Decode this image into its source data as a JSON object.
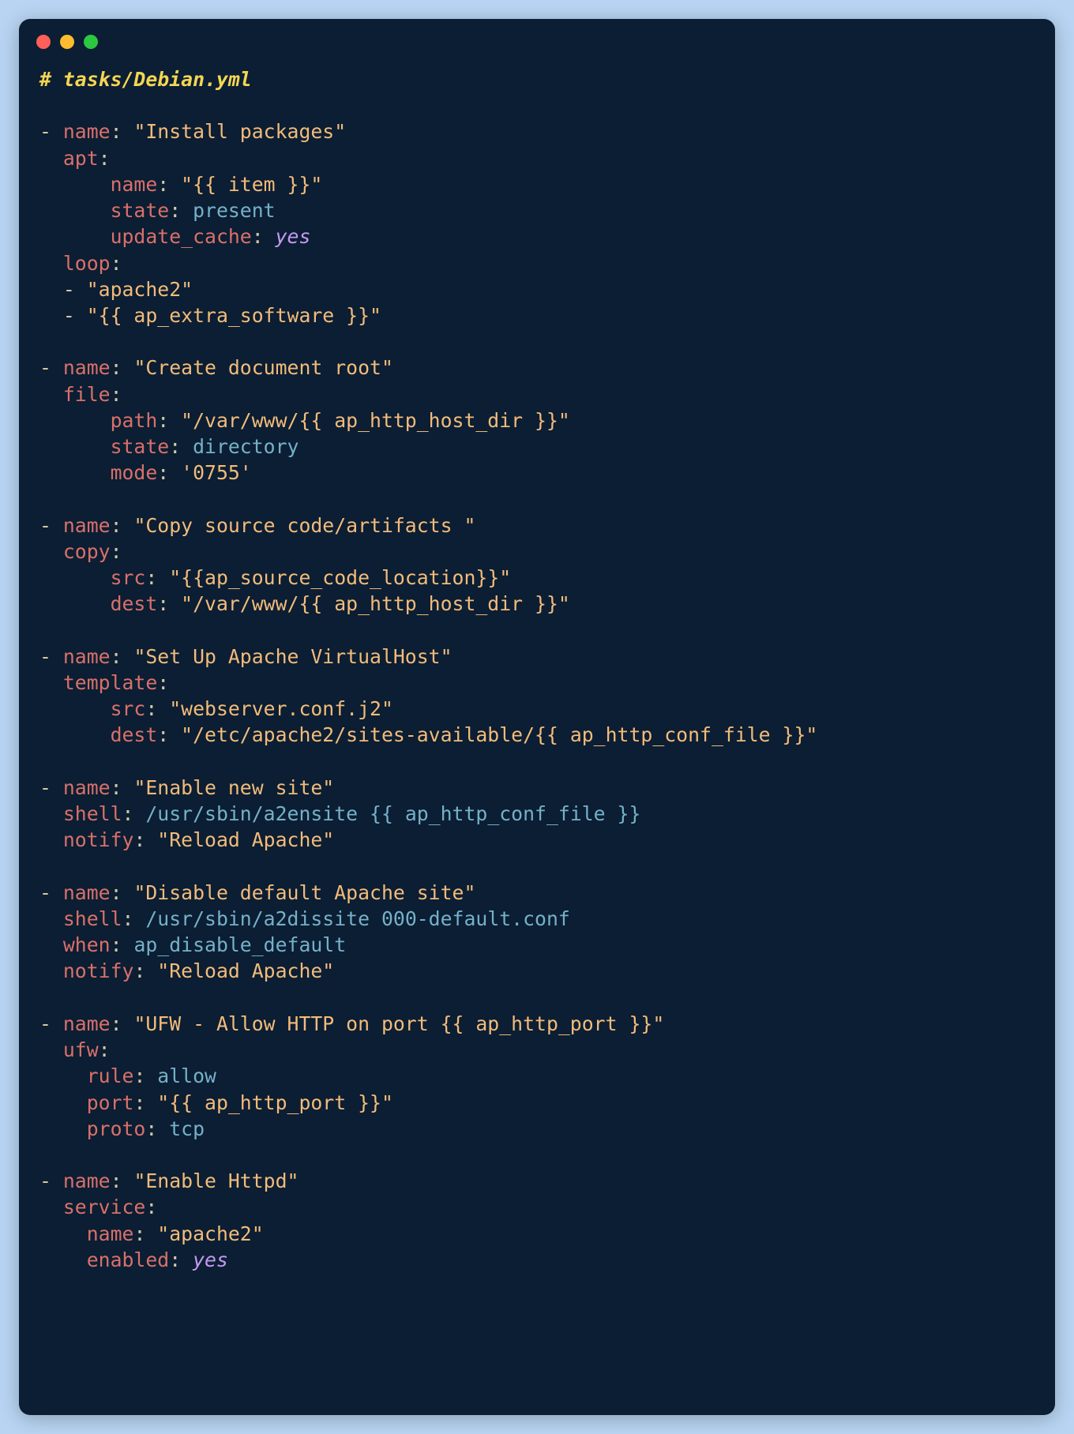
{
  "comment": "# tasks/Debian.yml",
  "tasks": [
    {
      "name": "\"Install packages\"",
      "module": "apt",
      "args": {
        "name": "\"{{ item }}\"",
        "state": "present",
        "update_cache": "yes"
      },
      "loop": [
        "\"apache2\"",
        "\"{{ ap_extra_software }}\""
      ]
    },
    {
      "name": "\"Create document root\"",
      "module": "file",
      "args": {
        "path": "\"/var/www/{{ ap_http_host_dir }}\"",
        "state": "directory",
        "mode": "'0755'"
      }
    },
    {
      "name": "\"Copy source code/artifacts \"",
      "module": "copy",
      "args": {
        "src": "\"{{ap_source_code_location}}\"",
        "dest": "\"/var/www/{{ ap_http_host_dir }}\""
      }
    },
    {
      "name": "\"Set Up Apache VirtualHost\"",
      "module": "template",
      "args": {
        "src": "\"webserver.conf.j2\"",
        "dest": "\"/etc/apache2/sites-available/{{ ap_http_conf_file }}\""
      }
    },
    {
      "name": "\"Enable new site\"",
      "flat": [
        {
          "k": "shell",
          "v": "/usr/sbin/a2ensite {{ ap_http_conf_file }}",
          "cls": "id"
        },
        {
          "k": "notify",
          "v": "\"Reload Apache\"",
          "cls": "str"
        }
      ]
    },
    {
      "name": "\"Disable default Apache site\"",
      "flat": [
        {
          "k": "shell",
          "v": "/usr/sbin/a2dissite 000-default.conf",
          "cls": "id"
        },
        {
          "k": "when",
          "v": "ap_disable_default",
          "cls": "id"
        },
        {
          "k": "notify",
          "v": "\"Reload Apache\"",
          "cls": "str"
        }
      ]
    },
    {
      "name": "\"UFW - Allow HTTP on port {{ ap_http_port }}\"",
      "module": "ufw",
      "indent4": true,
      "args": {
        "rule": "allow",
        "port": "\"{{ ap_http_port }}\"",
        "proto": "tcp"
      }
    },
    {
      "name": "\"Enable Httpd\"",
      "module": "service",
      "indent4": true,
      "args": {
        "name": "\"apache2\"",
        "enabled": "yes"
      }
    }
  ]
}
